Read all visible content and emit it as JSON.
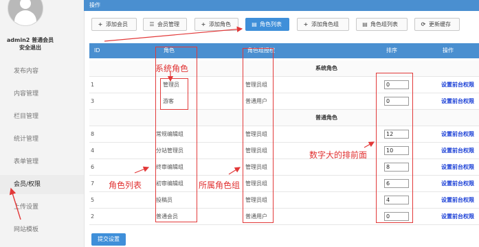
{
  "sidebar": {
    "user_line1": "admin2 普通会员",
    "user_line2": "安全退出",
    "items": [
      {
        "label": "发布内容"
      },
      {
        "label": "内容管理"
      },
      {
        "label": "栏目管理"
      },
      {
        "label": "统计管理"
      },
      {
        "label": "表单管理"
      },
      {
        "label": "会员/权限"
      },
      {
        "label": "上传设置"
      },
      {
        "label": "网站模板"
      }
    ]
  },
  "header": {
    "title": "操作"
  },
  "toolbar": {
    "buttons": [
      {
        "label": "添加会员",
        "icon": "plus-icon"
      },
      {
        "label": "会员管理",
        "icon": "list-icon"
      },
      {
        "label": "添加角色",
        "icon": "plus-icon"
      },
      {
        "label": "角色列表",
        "icon": "document-icon"
      },
      {
        "label": "添加角色组",
        "icon": "plus-icon"
      },
      {
        "label": "角色组列表",
        "icon": "document-icon"
      },
      {
        "label": "更新缓存",
        "icon": "refresh-icon"
      }
    ]
  },
  "table": {
    "headers": {
      "id": "ID",
      "role": "角色",
      "group": "角色组授权",
      "sort": "排序",
      "ops": "操作"
    },
    "system_group": "系统角色",
    "normal_group": "普通角色",
    "system_rows": [
      {
        "id": "1",
        "role": "管理员",
        "group": "管理员组",
        "sort": "0",
        "action": "设置前台权限"
      },
      {
        "id": "3",
        "role": "游客",
        "group": "普通用户",
        "sort": "0",
        "action": "设置前台权限"
      }
    ],
    "normal_rows": [
      {
        "id": "8",
        "role": "常规编辑组",
        "group": "管理员组",
        "sort": "12",
        "action": "设置前台权限"
      },
      {
        "id": "4",
        "role": "分站管理员",
        "group": "管理员组",
        "sort": "10",
        "action": "设置前台权限"
      },
      {
        "id": "6",
        "role": "终审编辑组",
        "group": "管理员组",
        "sort": "8",
        "action": "设置前台权限"
      },
      {
        "id": "7",
        "role": "初审编辑组",
        "group": "管理员组",
        "sort": "6",
        "action": "设置前台权限"
      },
      {
        "id": "5",
        "role": "投稿员",
        "group": "管理员组",
        "sort": "4",
        "action": "设置前台权限"
      },
      {
        "id": "2",
        "role": "普通会员",
        "group": "普通用户",
        "sort": "0",
        "action": "设置前台权限"
      }
    ]
  },
  "submit_label": "提交设置",
  "annotations": {
    "system_roles": "系统角色",
    "role_list": "角色列表",
    "role_group": "所属角色组",
    "sort_note": "数字大的排前面"
  },
  "colors": {
    "accent": "#3f8fd9",
    "header": "#4a8fd0",
    "annotation": "#e23838",
    "link": "#1a3fd6"
  }
}
